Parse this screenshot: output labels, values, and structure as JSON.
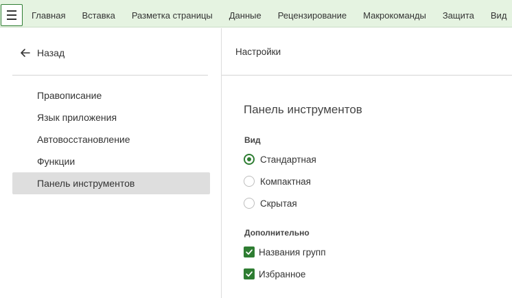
{
  "ribbon": {
    "menu_icon": "hamburger-icon",
    "tabs": [
      "Главная",
      "Вставка",
      "Разметка страницы",
      "Данные",
      "Рецензирование",
      "Макрокоманды",
      "Защита",
      "Вид"
    ]
  },
  "sidebar": {
    "back_label": "Назад",
    "back_icon": "arrow-left-icon",
    "items": [
      {
        "label": "Правописание",
        "active": false
      },
      {
        "label": "Язык приложения",
        "active": false
      },
      {
        "label": "Автовосстановление",
        "active": false
      },
      {
        "label": "Функции",
        "active": false
      },
      {
        "label": "Панель инструментов",
        "active": true
      }
    ]
  },
  "main": {
    "header": "Настройки",
    "section_title": "Панель инструментов",
    "view_group": {
      "label": "Вид",
      "options": [
        {
          "label": "Стандартная",
          "checked": true
        },
        {
          "label": "Компактная",
          "checked": false
        },
        {
          "label": "Скрытая",
          "checked": false
        }
      ]
    },
    "extra_group": {
      "label": "Дополнительно",
      "options": [
        {
          "label": "Названия групп",
          "checked": true
        },
        {
          "label": "Избранное",
          "checked": true
        }
      ]
    }
  },
  "colors": {
    "accent": "#2e7d32",
    "ribbon_bg": "#e5f3e1",
    "active_item_bg": "#dedede"
  }
}
